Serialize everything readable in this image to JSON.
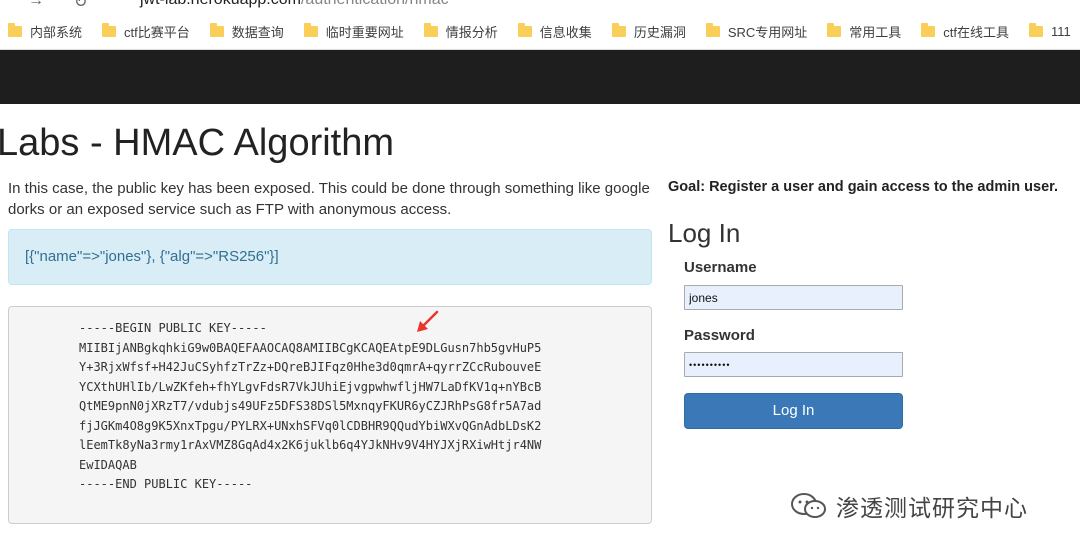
{
  "browser": {
    "url_host": "jwt-lab.herokuapp.com",
    "url_path": "/authentication/hmac",
    "bookmarks": [
      {
        "label": "内部系统"
      },
      {
        "label": "ctf比赛平台"
      },
      {
        "label": "数据查询"
      },
      {
        "label": "临时重要网址"
      },
      {
        "label": "情报分析"
      },
      {
        "label": "信息收集"
      },
      {
        "label": "历史漏洞"
      },
      {
        "label": "SRC专用网址"
      },
      {
        "label": "常用工具"
      },
      {
        "label": "ctf在线工具"
      },
      {
        "label": "111"
      }
    ]
  },
  "page": {
    "title": "Labs - HMAC Algorithm",
    "intro": "In this case, the public key has been exposed. This could be done through something like google dorks or an exposed service such as FTP with anonymous access.",
    "alert": "[{\"name\"=>\"jones\"}, {\"alg\"=>\"RS256\"}]",
    "public_key_lines": [
      "-----BEGIN PUBLIC KEY-----",
      "MIIBIjANBgkqhkiG9w0BAQEFAAOCAQ8AMIIBCgKCAQEAtpE9DLGusn7hb5gvHuP5",
      "Y+3RjxWfsf+H42JuCSyhfzTrZz+DQreBJIFqz0Hhe3d0qmrA+qyrrZCcRubouveE",
      "YCXthUHlIb/LwZKfeh+fhYLgvFdsR7VkJUhiEjvgpwhwfljHW7LaDfKV1q+nYBcB",
      "QtME9pnN0jXRzT7/vdubjs49UFz5DFS38DSl5MxnqyFKUR6yCZJRhPsG8fr5A7ad",
      "fjJGKm4O8g9K5XnxTpgu/PYLRX+UNxhSFVq0lCDBHR9QQudYbiWXvQGnAdbLDsK2",
      "lEemTk8yNa3rmy1rAxVMZ8GqAd4x2K6juklb6q4YJkNHv9V4HYJXjRXiwHtjr4NW",
      "EwIDAQAB",
      "-----END PUBLIC KEY-----"
    ]
  },
  "login": {
    "goal": "Goal: Register a user and gain access to the admin user.",
    "heading": "Log In",
    "username_label": "Username",
    "username_value": "jones",
    "password_label": "Password",
    "password_value": "••••••••••",
    "submit_label": "Log In"
  },
  "watermark": {
    "text": "渗透测试研究中心"
  },
  "colors": {
    "navbar": "#1e1e1e",
    "alert_bg": "#d9edf7",
    "alert_text": "#31708f",
    "button": "#3a78b8",
    "arrow": "#e8362d"
  }
}
